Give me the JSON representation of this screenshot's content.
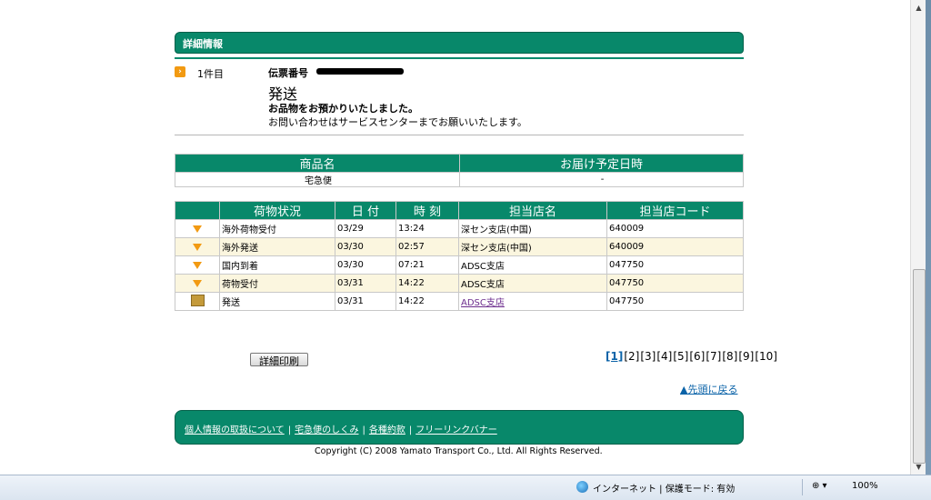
{
  "header": {
    "title": "詳細情報"
  },
  "shipment": {
    "count_label": "1件目",
    "slip_label": "伝票番号",
    "status_title": "発送",
    "status_message": "お品物をお預かりいたしました。",
    "inquiry_note": "お問い合わせはサービスセンターまでお願いいたします。"
  },
  "item_table": {
    "headers": [
      "商品名",
      "お届け予定日時"
    ],
    "row": [
      "宅急便",
      "-"
    ]
  },
  "history_table": {
    "headers": [
      "荷物状況",
      "日 付",
      "時 刻",
      "担当店名",
      "担当店コード"
    ],
    "rows": [
      [
        "海外荷物受付",
        "03/29",
        "13:24",
        "深セン支店(中国)",
        "640009"
      ],
      [
        "海外発送",
        "03/30",
        "02:57",
        "深セン支店(中国)",
        "640009"
      ],
      [
        "国内到着",
        "03/30",
        "07:21",
        "ADSC支店",
        "047750"
      ],
      [
        "荷物受付",
        "03/31",
        "14:22",
        "ADSC支店",
        "047750"
      ],
      [
        "発送",
        "03/31",
        "14:22",
        "ADSC支店",
        "047750"
      ]
    ]
  },
  "actions": {
    "print_button": "詳細印刷",
    "pager": [
      "[1]",
      "[2]",
      "[3]",
      "[4]",
      "[5]",
      "[6]",
      "[7]",
      "[8]",
      "[9]",
      "[10]"
    ],
    "back_to_top": "▲先頭に戻る"
  },
  "footer": {
    "links": [
      "個人情報の取扱について",
      "宅急便のしくみ",
      "各種約款",
      "フリーリンクバナー"
    ],
    "copyright": "Copyright (C) 2008 Yamato Transport Co., Ltd. All Rights Reserved."
  },
  "statusbar": {
    "zone": "インターネット | 保護モード: 有効",
    "zoom": "100%",
    "tools": "⊕ ▾"
  },
  "colors": {
    "brand_green": "#08886a",
    "row_tint": "#fbf6df",
    "link": "#0b63a8"
  }
}
